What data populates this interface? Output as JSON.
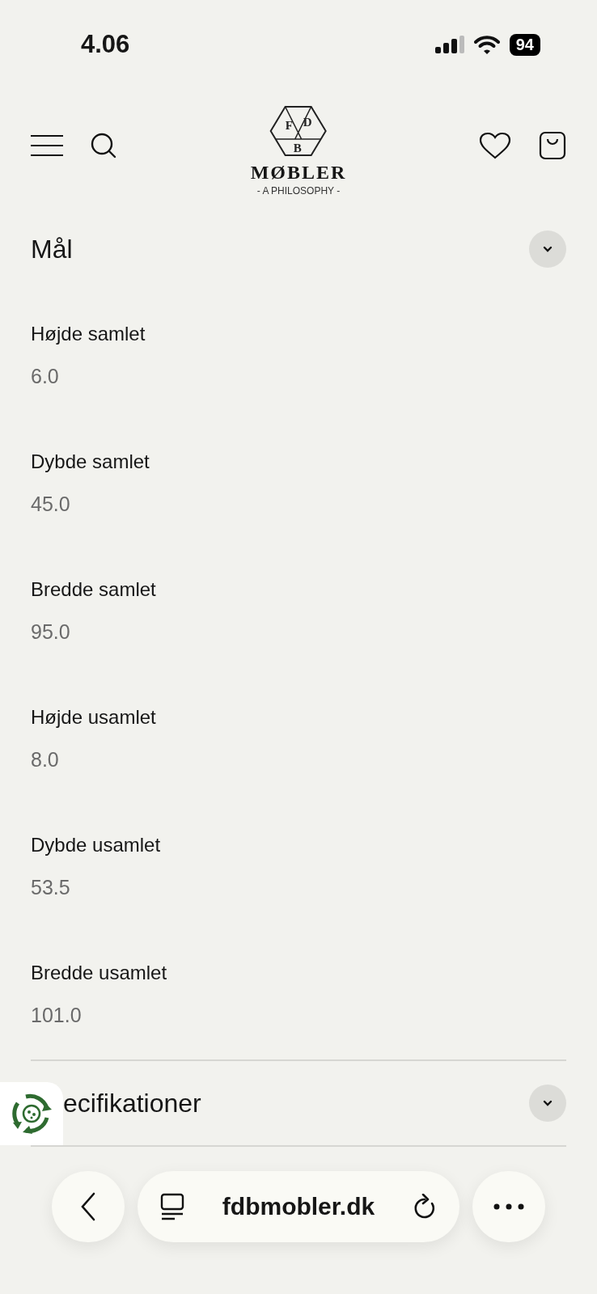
{
  "status_bar": {
    "time": "4.06",
    "battery": "94"
  },
  "header": {
    "logo": {
      "letters": [
        "F",
        "D",
        "B"
      ],
      "name": "MØBLER",
      "tagline": "- A PHILOSOPHY -"
    }
  },
  "sections": [
    {
      "title": "Mål",
      "items": [
        {
          "label": "Højde samlet",
          "value": "6.0"
        },
        {
          "label": "Dybde samlet",
          "value": "45.0"
        },
        {
          "label": "Bredde samlet",
          "value": "95.0"
        },
        {
          "label": "Højde usamlet",
          "value": "8.0"
        },
        {
          "label": "Dybde usamlet",
          "value": "53.5"
        },
        {
          "label": "Bredde usamlet",
          "value": "101.0"
        }
      ]
    },
    {
      "title": "ecifikationer"
    }
  ],
  "browser_bar": {
    "url": "fdbmobler.dk"
  }
}
